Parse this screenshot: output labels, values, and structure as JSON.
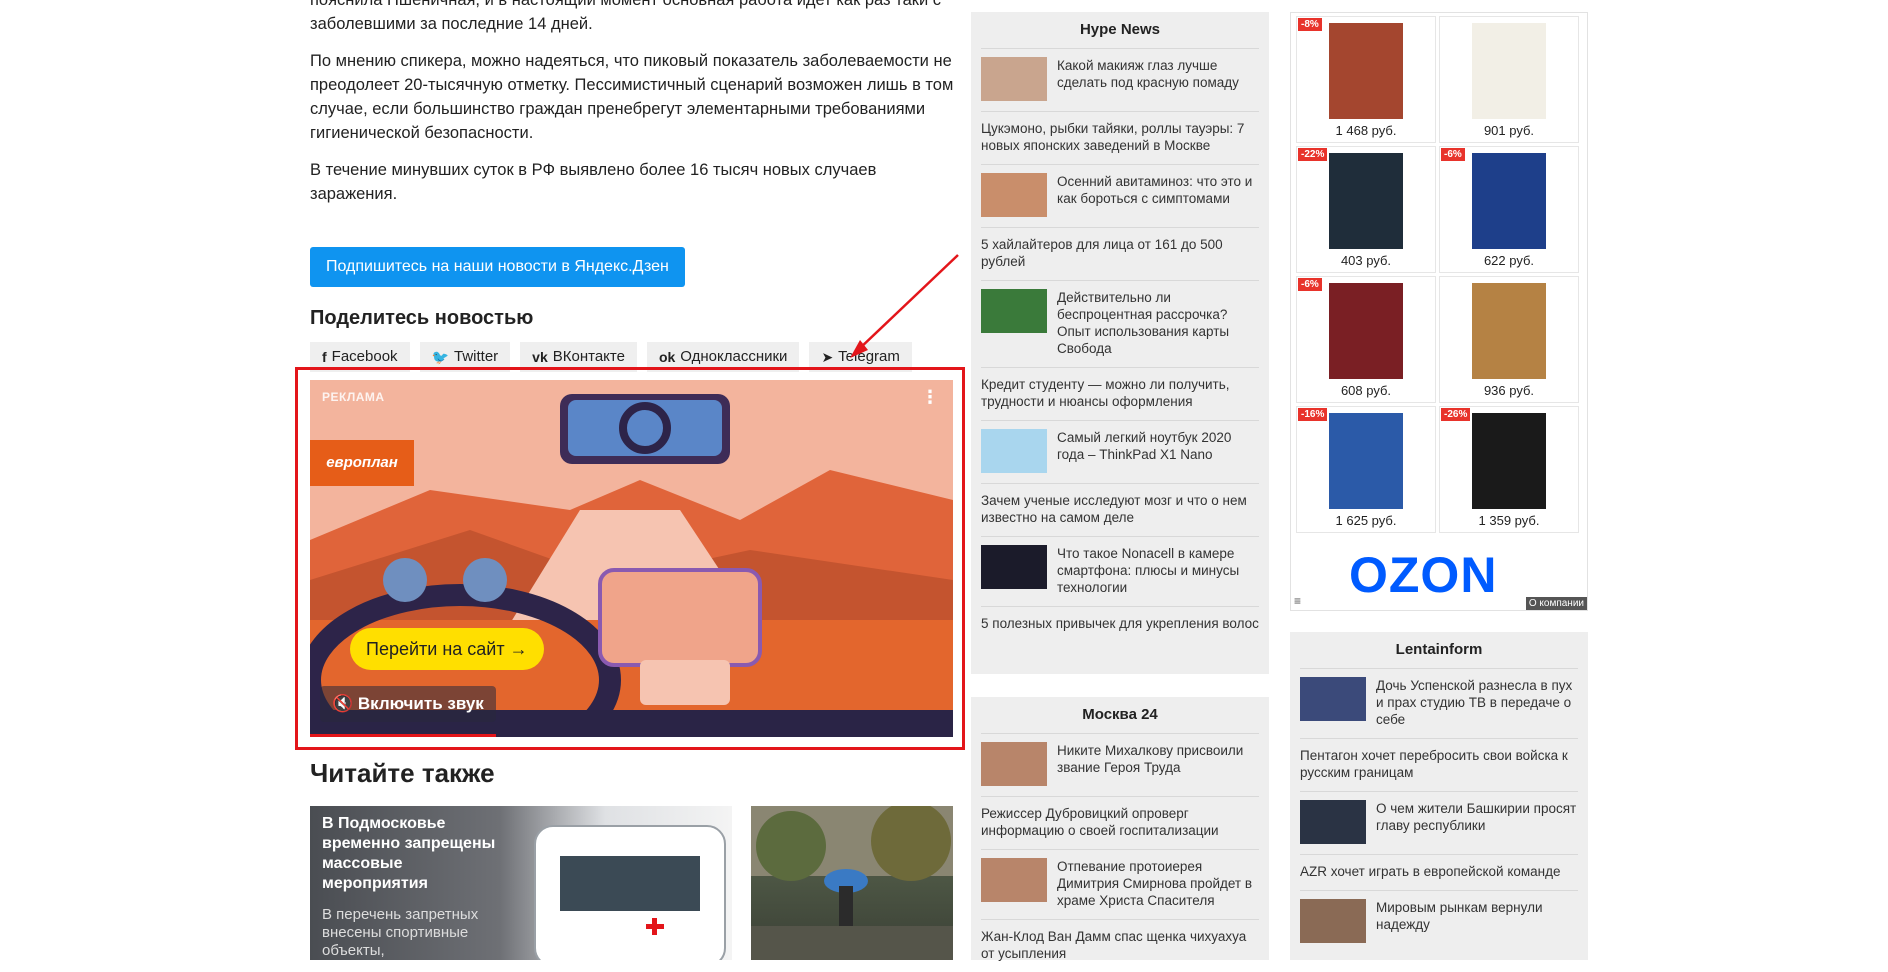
{
  "article": {
    "paragraphs": [
      "пояснила Пшеничная, и в настоящий момент основная работа идет как раз таки с заболевшими за последние 14 дней.",
      "По мнению спикера, можно надеяться, что пиковый показатель заболеваемости не преодолеет 20-тысячную отметку. Пессимистичный сценарий возможен лишь в том случае, если большинство граждан пренебрегут элементарными требованиями гигиенической безопасности.",
      "В течение минувших суток в РФ выявлено более 16 тысяч новых случаев заражения."
    ],
    "dzen_button": "Подпишитесь на наши новости в Яндекс.Дзен",
    "share_title": "Поделитесь новостью",
    "share_buttons": [
      {
        "icon": "f",
        "label": "Facebook"
      },
      {
        "icon": "🐦",
        "label": "Twitter"
      },
      {
        "icon": "vk",
        "label": "ВКонтакте"
      },
      {
        "icon": "ok",
        "label": "Одноклассники"
      },
      {
        "icon": "➤",
        "label": "Telegram"
      }
    ]
  },
  "ad": {
    "label": "РЕКЛАМА",
    "brand": "европлан",
    "cta": "Перейти на сайт →",
    "sound": "🔇 Включить звук",
    "menu": "⋮",
    "progress_fraction": 0.29
  },
  "also": {
    "title": "Читайте также",
    "cards": [
      {
        "title": "В Подмосковье временно запрещены массовые мероприятия",
        "desc": "В перечень запретных внесены спортивные объекты,"
      },
      {
        "title": "",
        "desc": ""
      }
    ]
  },
  "hype": {
    "title": "Hype News",
    "items": [
      {
        "text": "Какой макияж глаз лучше сделать под красную помаду",
        "thumb": true
      },
      {
        "text": "Цукэмоно, рыбки тайяки, роллы тауэры: 7 новых японских заведений в Москве",
        "thumb": false
      },
      {
        "text": "Осенний авитаминоз: что это и как бороться с симптомами",
        "thumb": true
      },
      {
        "text": "5 хайлайтеров для лица от 161 до 500 рублей",
        "thumb": false
      },
      {
        "text": "Действительно ли беспроцентная рассрочка? Опыт использования карты Свобода",
        "thumb": true
      },
      {
        "text": "Кредит студенту — можно ли получить, трудности и нюансы оформления",
        "thumb": false
      },
      {
        "text": "Самый легкий ноутбук 2020 года – ThinkPad X1 Nano",
        "thumb": true
      },
      {
        "text": "Зачем ученые исследуют мозг и что о нем известно на самом деле",
        "thumb": false
      },
      {
        "text": "Что такое Nonacell в камере смартфона: плюсы и минусы технологии",
        "thumb": true
      },
      {
        "text": "5 полезных привычек для укрепления волос",
        "thumb": false
      }
    ]
  },
  "moscow24": {
    "title": "Москва 24",
    "items": [
      {
        "text": "Никите Михалкову присвоили звание Героя Труда",
        "thumb": true
      },
      {
        "text": "Режиссер Дубровицкий опроверг информацию о своей госпитализации",
        "thumb": false
      },
      {
        "text": "Отпевание протоиерея Димитрия Смирнова пройдет в храме Христа Спасителя",
        "thumb": true
      },
      {
        "text": "Жан-Клод Ван Дамм спас щенка чихуахуа от усыпления",
        "thumb": false
      }
    ]
  },
  "lentainform": {
    "title": "Lentainform",
    "items": [
      {
        "text": "Дочь Успенской разнесла в пух и прах студию ТВ в передаче о себе",
        "thumb": true
      },
      {
        "text": "Пентагон хочет перебросить свои войска к русским границам",
        "thumb": false
      },
      {
        "text": "О чем жители Башкирии просят главу республики",
        "thumb": true
      },
      {
        "text": "AZR хочет играть в европейской команде",
        "thumb": false
      },
      {
        "text": "Мировым рынкам вернули надежду",
        "thumb": true
      }
    ]
  },
  "ozon": {
    "logo": "OZON",
    "about": "О компании",
    "menu": "≡",
    "books": [
      {
        "price": "1 468 руб.",
        "discount": "-8%",
        "cover": "#a4462f"
      },
      {
        "price": "901 руб.",
        "discount": "",
        "cover": "#f2efe6"
      },
      {
        "price": "403 руб.",
        "discount": "-22%",
        "cover": "#1f2d3a"
      },
      {
        "price": "622 руб.",
        "discount": "-6%",
        "cover": "#1e3f8a"
      },
      {
        "price": "608 руб.",
        "discount": "-6%",
        "cover": "#7a1f24"
      },
      {
        "price": "936 руб.",
        "discount": "",
        "cover": "#b58244"
      },
      {
        "price": "1 625 руб.",
        "discount": "-16%",
        "cover": "#2b5aa8"
      },
      {
        "price": "1 359 руб.",
        "discount": "-26%",
        "cover": "#1a1a1a"
      }
    ]
  }
}
